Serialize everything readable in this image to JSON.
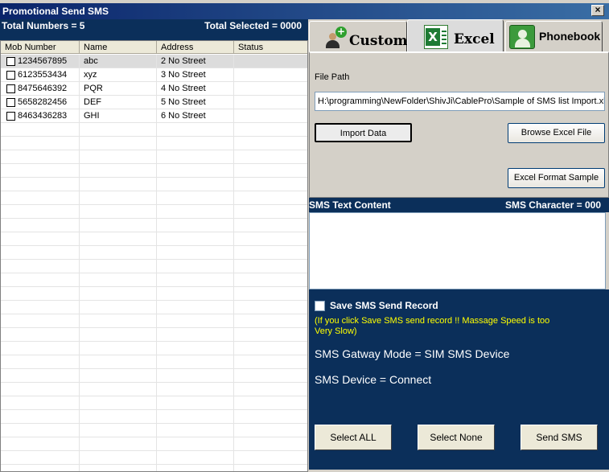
{
  "window": {
    "title": "Promotional Send SMS",
    "close_glyph": "×"
  },
  "left": {
    "total_numbers": "Total Numbers = 5",
    "total_selected": "Total Selected = 0000",
    "columns": [
      "Mob Number",
      "Name",
      "Address",
      "Status"
    ],
    "rows": [
      {
        "mob": "1234567895",
        "name": "abc",
        "address": "2 No Street",
        "status": ""
      },
      {
        "mob": "6123553434",
        "name": "xyz",
        "address": "3 No Street",
        "status": ""
      },
      {
        "mob": "8475646392",
        "name": "PQR",
        "address": "4 No Street",
        "status": ""
      },
      {
        "mob": "5658282456",
        "name": "DEF",
        "address": "5 No Street",
        "status": ""
      },
      {
        "mob": "8463436283",
        "name": "GHI",
        "address": "6 No Street",
        "status": ""
      }
    ]
  },
  "tabs": {
    "custome": "Custome",
    "excel": "Excel",
    "phonebook": "Phonebook",
    "active": "excel"
  },
  "excel": {
    "file_path_label": "File Path",
    "file_path_value": "H:\\programming\\NewFolder\\ShivJi\\CablePro\\Sample of SMS list Import.xls;",
    "import_label": "Import Data",
    "browse_label": "Browse Excel File",
    "format_label": "Excel Format Sample"
  },
  "sms": {
    "content_label": "SMS Text Content",
    "character_label": "SMS Character = 000"
  },
  "bottom": {
    "save_record_label": "Save SMS Send Record",
    "warning": "(If you click Save SMS send record !! Massage Speed is too Very Slow)",
    "mode": "SMS Gatway Mode = SIM SMS Device",
    "device": "SMS Device = Connect",
    "select_all": "Select ALL",
    "select_none": "Select None",
    "send_sms": "Send SMS"
  },
  "icons": {
    "scroll_left": "◀",
    "scroll_right": "▶",
    "excel_letter": "X",
    "add_plus": "+"
  }
}
